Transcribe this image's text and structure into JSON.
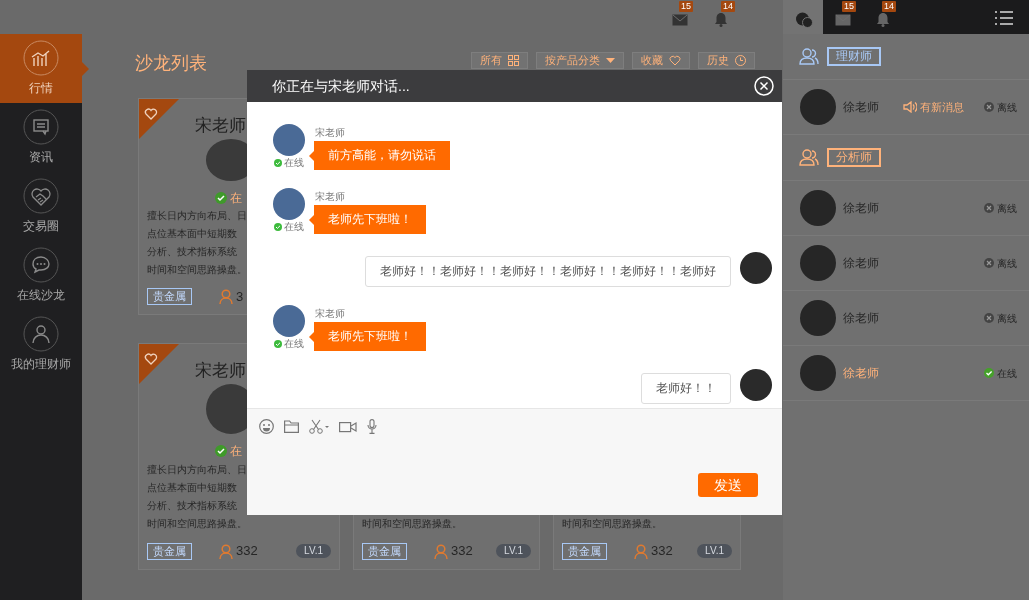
{
  "top_bar": {
    "badges": [
      {
        "count": "15"
      },
      {
        "count": "14"
      }
    ]
  },
  "sidebar": {
    "items": [
      {
        "label": "行情",
        "selected": true
      },
      {
        "label": "资讯",
        "selected": false
      },
      {
        "label": "交易圈",
        "selected": false
      },
      {
        "label": "在线沙龙",
        "selected": false
      },
      {
        "label": "我的理财师",
        "selected": false
      }
    ]
  },
  "page_title": "沙龙列表",
  "filters": [
    {
      "label": "所有"
    },
    {
      "label": "按产品分类"
    },
    {
      "label": "收藏"
    },
    {
      "label": "历史"
    }
  ],
  "cards": [
    {
      "favorite": true,
      "title": "宋老师",
      "photo": true,
      "status": "在",
      "online": true,
      "description": [
        "擅长日内方向布局、日",
        "点位基本面中短期数",
        "分析、技术指标系统",
        "时间和空间思路操盘。"
      ],
      "tag": "贵金属",
      "followers": "3"
    },
    {
      "favorite": true,
      "title": "宋老师",
      "photo": true,
      "status": "在",
      "online": true,
      "description": [
        "擅长日内方向布局、日",
        "点位基本面中短期数",
        "分析、技术指标系统",
        "时间和空间思路操盘。"
      ],
      "tag": "贵金属",
      "followers": "332",
      "level": "LV.1"
    },
    {
      "description": [
        "时间和空间思路操盘。"
      ],
      "tag": "贵金属",
      "followers": "332",
      "level": "LV.1"
    },
    {
      "description": [
        "时间和空间思路操盘。"
      ],
      "tag": "贵金属",
      "followers": "332",
      "level": "LV.1"
    }
  ],
  "right_panel": {
    "tabs": [
      {
        "selected": true
      },
      {
        "selected": false,
        "count": "15"
      },
      {
        "selected": false,
        "count": "14"
      }
    ],
    "groups": [
      {
        "label": "理财师",
        "color": "#a8c8f5",
        "contacts": [
          {
            "name": "徐老师",
            "notice": "有新消息",
            "status": "离线",
            "online": false
          }
        ]
      },
      {
        "label": "分析师",
        "color": "#ffb27a",
        "contacts": [
          {
            "name": "徐老师",
            "status": "离线",
            "online": false
          },
          {
            "name": "徐老师",
            "status": "离线",
            "online": false
          },
          {
            "name": "徐老师",
            "status": "离线",
            "online": false
          },
          {
            "name": "徐老师",
            "status": "在线",
            "online": true
          }
        ]
      }
    ]
  },
  "chat": {
    "title": "你正在与宋老师对话...",
    "messages": [
      {
        "kind": "received",
        "sender": "宋老师",
        "status": "在线",
        "text": "前方高能，请勿说话"
      },
      {
        "kind": "received",
        "sender": "宋老师",
        "status": "在线",
        "text": "老师先下班啦！"
      },
      {
        "kind": "sent",
        "text": "老师好！！老师好！！老师好！！老师好！！老师好！！老师好"
      },
      {
        "kind": "received",
        "sender": "宋老师",
        "status": "在线",
        "text": "老师先下班啦！"
      },
      {
        "kind": "sent",
        "text": "老师好！！"
      }
    ],
    "send_label": "发送"
  }
}
